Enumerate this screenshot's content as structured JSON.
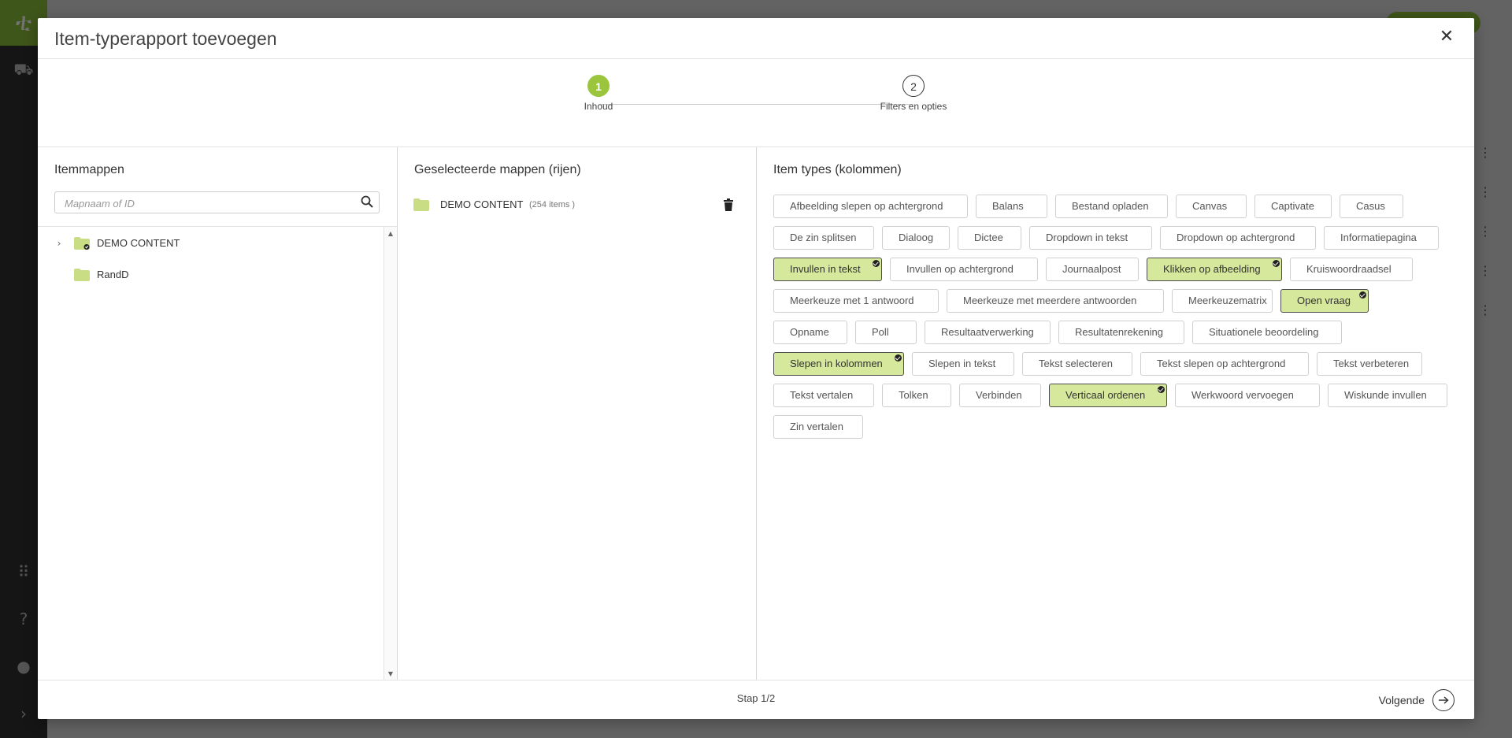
{
  "modal": {
    "title": "Item-typerapport toevoegen",
    "close_icon": "close-icon"
  },
  "stepper": {
    "steps": [
      {
        "number": "1",
        "label": "Inhoud",
        "state": "active"
      },
      {
        "number": "2",
        "label": "Filters en opties",
        "state": "todo"
      }
    ]
  },
  "left_panel": {
    "title": "Itemmappen",
    "search_placeholder": "Mapnaam of ID",
    "search_value": "",
    "tree": [
      {
        "name": "DEMO CONTENT",
        "expandable": true,
        "selected": true
      },
      {
        "name": "RandD",
        "expandable": false,
        "selected": false
      }
    ]
  },
  "middle_panel": {
    "title": "Geselecteerde mappen (rijen)",
    "rows": [
      {
        "name": "DEMO CONTENT",
        "count": "(254 items )"
      }
    ]
  },
  "right_panel": {
    "title": "Item types (kolommen)",
    "rows": [
      [
        {
          "label": "Afbeelding slepen op achtergrond",
          "selected": false
        },
        {
          "label": "Balans",
          "selected": false
        },
        {
          "label": "Bestand opladen",
          "selected": false
        },
        {
          "label": "Canvas",
          "selected": false
        },
        {
          "label": "Captivate",
          "selected": false
        },
        {
          "label": "Casus",
          "selected": false
        }
      ],
      [
        {
          "label": "De zin splitsen",
          "selected": false
        },
        {
          "label": "Dialoog",
          "selected": false
        },
        {
          "label": "Dictee",
          "selected": false
        },
        {
          "label": "Dropdown in tekst",
          "selected": false
        },
        {
          "label": "Dropdown op achtergrond",
          "selected": false
        },
        {
          "label": "Informatiepagina",
          "selected": false
        }
      ],
      [
        {
          "label": "Invullen in tekst",
          "selected": true
        },
        {
          "label": "Invullen op achtergrond",
          "selected": false
        },
        {
          "label": "Journaalpost",
          "selected": false
        },
        {
          "label": "Klikken op afbeelding",
          "selected": true
        },
        {
          "label": "Kruiswoordraadsel",
          "selected": false
        }
      ],
      [
        {
          "label": "Meerkeuze met 1 antwoord",
          "selected": false
        },
        {
          "label": "Meerkeuze met meerdere antwoorden",
          "selected": false
        },
        {
          "label": "Meerkeuzematrix",
          "selected": false
        },
        {
          "label": "Open vraag",
          "selected": true
        }
      ],
      [
        {
          "label": "Opname",
          "selected": false
        },
        {
          "label": "Poll",
          "selected": false
        },
        {
          "label": "Resultaatverwerking",
          "selected": false
        },
        {
          "label": "Resultatenrekening",
          "selected": false
        },
        {
          "label": "Situationele beoordeling",
          "selected": false
        }
      ],
      [
        {
          "label": "Slepen in kolommen",
          "selected": true
        },
        {
          "label": "Slepen in tekst",
          "selected": false
        },
        {
          "label": "Tekst selecteren",
          "selected": false
        },
        {
          "label": "Tekst slepen op achtergrond",
          "selected": false
        },
        {
          "label": "Tekst verbeteren",
          "selected": false
        }
      ],
      [
        {
          "label": "Tekst vertalen",
          "selected": false
        },
        {
          "label": "Tolken",
          "selected": false
        },
        {
          "label": "Verbinden",
          "selected": false
        },
        {
          "label": "Verticaal ordenen",
          "selected": true
        },
        {
          "label": "Werkwoord vervoegen",
          "selected": false
        },
        {
          "label": "Wiskunde invullen",
          "selected": false
        }
      ],
      [
        {
          "label": "Zin vertalen",
          "selected": false
        }
      ]
    ]
  },
  "footer": {
    "step_indicator": "Stap 1/2",
    "next_label": "Volgende"
  },
  "colors": {
    "accent": "#9bc53d",
    "chip_selected_bg": "#d6e89b",
    "brand": "#8dbf3a"
  }
}
